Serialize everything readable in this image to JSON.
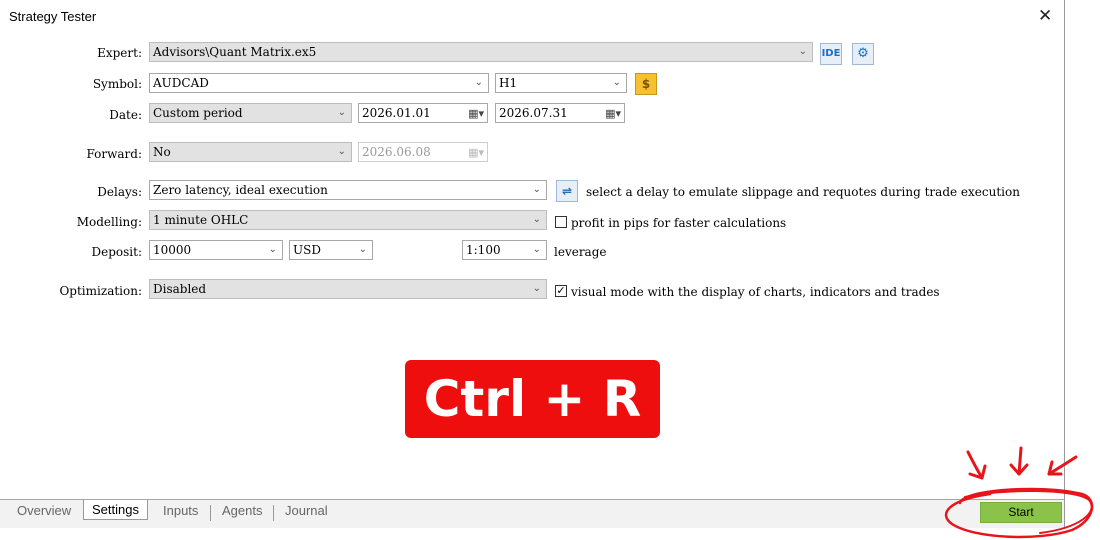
{
  "window": {
    "title": "Strategy Tester"
  },
  "form": {
    "expert": {
      "label": "Expert:",
      "value": "Advisors\\Quant Matrix.ex5"
    },
    "symbol": {
      "label": "Symbol:",
      "value": "AUDCAD",
      "timeframe": "H1"
    },
    "date": {
      "label": "Date:",
      "period": "Custom period",
      "from": "2026.01.01",
      "to": "2026.07.31"
    },
    "forward": {
      "label": "Forward:",
      "value": "No",
      "date": "2026.06.08"
    },
    "delays": {
      "label": "Delays:",
      "value": "Zero latency, ideal execution",
      "hint": "select a delay to emulate slippage and requotes during trade execution"
    },
    "modelling": {
      "label": "Modelling:",
      "value": "1 minute OHLC",
      "checkbox_label": "profit in pips for faster calculations",
      "checked": false
    },
    "deposit": {
      "label": "Deposit:",
      "value": "10000",
      "currency": "USD",
      "leverage_value": "1:100",
      "leverage_label": "leverage"
    },
    "optimization": {
      "label": "Optimization:",
      "value": "Disabled",
      "checkbox_label": "visual mode with the display of charts, indicators and trades",
      "checked": true
    }
  },
  "buttons": {
    "ide": "IDE",
    "start": "Start"
  },
  "overlay": {
    "shortcut": "Ctrl + R"
  },
  "tabs": [
    "Overview",
    "Settings",
    "Inputs",
    "Agents",
    "Journal"
  ],
  "colors": {
    "start": "#8bc34a",
    "overlay": "#ee0e0e",
    "annotation": "#e8141a"
  }
}
